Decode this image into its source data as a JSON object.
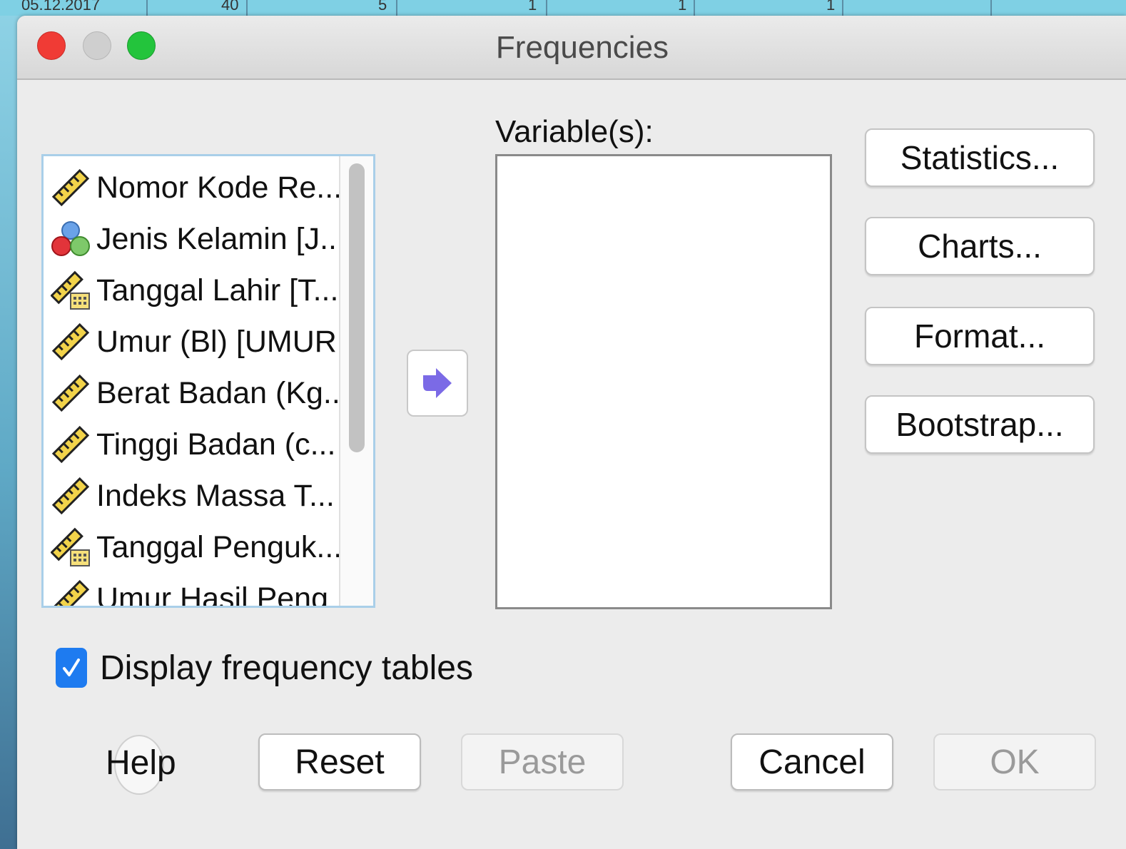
{
  "background": {
    "cells": [
      "05.12.2017",
      "40",
      "5",
      "1",
      "1",
      "1"
    ]
  },
  "window": {
    "title": "Frequencies"
  },
  "variable_list": {
    "items": [
      {
        "label": "Nomor Kode Re...",
        "icon": "scale-ruler-icon"
      },
      {
        "label": "Jenis Kelamin [J...",
        "icon": "nominal-balls-icon"
      },
      {
        "label": "Tanggal Lahir [T...",
        "icon": "date-ruler-icon"
      },
      {
        "label": "Umur (Bl) [UMUR...",
        "icon": "scale-ruler-icon"
      },
      {
        "label": "Berat Badan (Kg...",
        "icon": "scale-ruler-icon"
      },
      {
        "label": "Tinggi Badan (c...",
        "icon": "scale-ruler-icon"
      },
      {
        "label": "Indeks Massa T...",
        "icon": "scale-ruler-icon"
      },
      {
        "label": "Tanggal Penguk...",
        "icon": "date-ruler-icon"
      },
      {
        "label": "Umur Hasil Peng",
        "icon": "scale-ruler-icon"
      }
    ]
  },
  "target": {
    "label": "Variable(s):"
  },
  "side_buttons": {
    "statistics": "Statistics...",
    "charts": "Charts...",
    "format": "Format...",
    "bootstrap": "Bootstrap..."
  },
  "options": {
    "display_frequency_tables": {
      "label": "Display frequency tables",
      "checked": true
    }
  },
  "footer": {
    "help": "Help",
    "reset": "Reset",
    "paste": "Paste",
    "cancel": "Cancel",
    "ok": "OK"
  },
  "colors": {
    "close": "#f03b35",
    "minimize": "#cfcfcf",
    "maximize": "#23c43c",
    "checkbox": "#1e7bf0",
    "arrow": "#7b6ae6"
  }
}
